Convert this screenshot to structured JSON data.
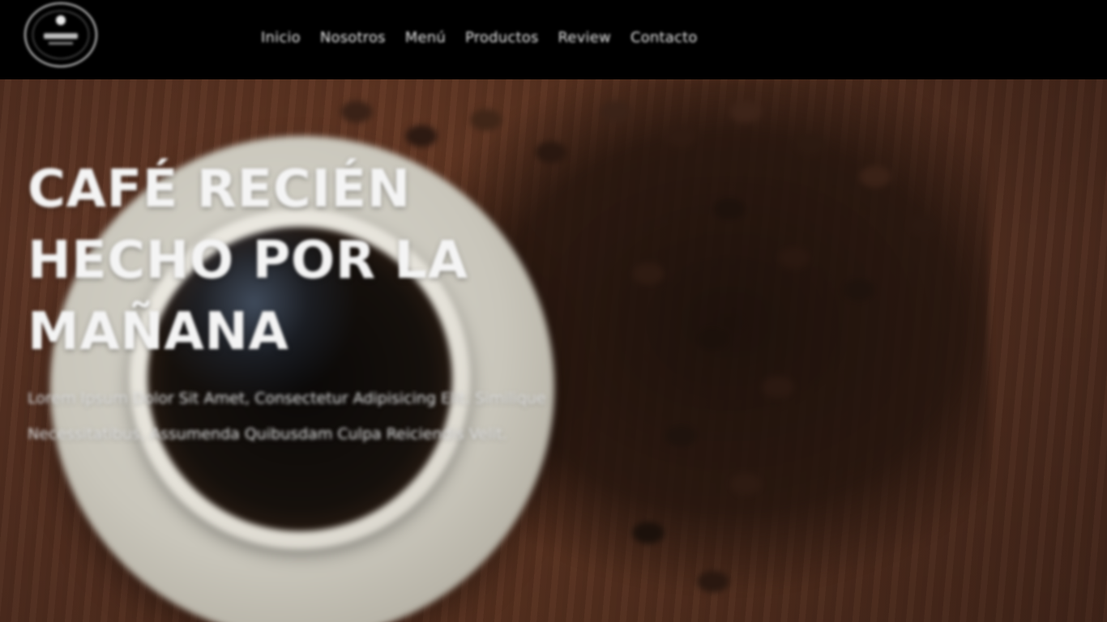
{
  "header": {
    "logo_icon": "coffee-shop-logo-icon",
    "nav": [
      {
        "label": "Inicio"
      },
      {
        "label": "Nosotros"
      },
      {
        "label": "Menú"
      },
      {
        "label": "Productos"
      },
      {
        "label": "Review"
      },
      {
        "label": "Contacto"
      }
    ]
  },
  "hero": {
    "title": "CAFÉ RECIÉN HECHO POR LA MAÑANA",
    "text": "Lorem Ipsum Dolor Sit Amet, Consectetur Adipisicing Elit. Similique Necessitatibus, Assumenda Quibusdam Culpa Reiciendis Velit."
  },
  "colors": {
    "header_bg": "#000000",
    "text": "#f4f4f4",
    "wood": "#5a3323"
  }
}
